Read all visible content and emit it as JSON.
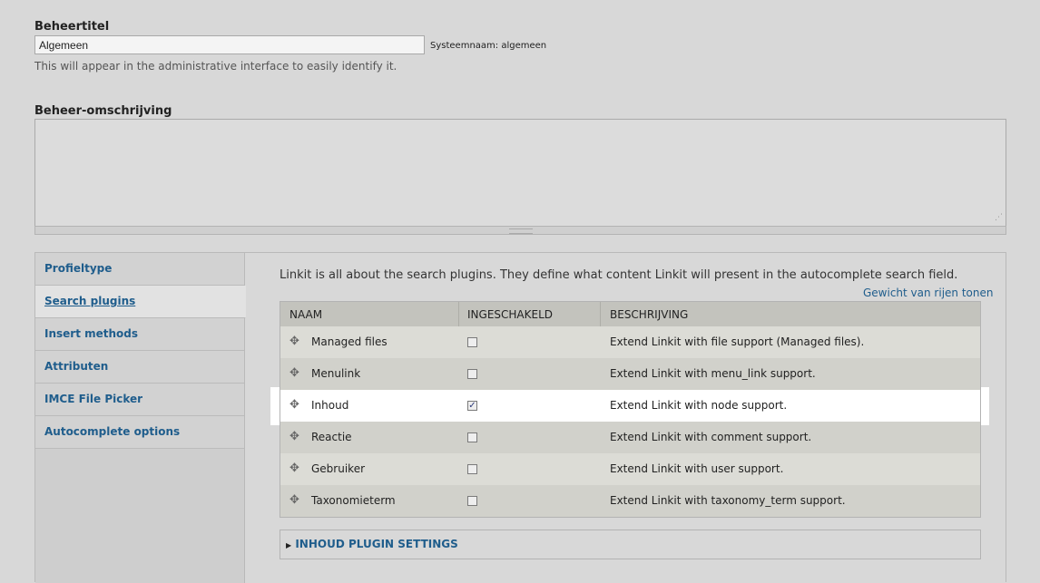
{
  "admin_title": {
    "label": "Beheertitel",
    "value": "Algemeen",
    "machine_name": "Systeemnaam: algemeen",
    "help": "This will appear in the administrative interface to easily identify it."
  },
  "admin_description": {
    "label": "Beheer-omschrijving",
    "value": ""
  },
  "vertical_tabs": [
    {
      "label": "Profieltype"
    },
    {
      "label": "Search plugins"
    },
    {
      "label": "Insert methods"
    },
    {
      "label": "Attributen"
    },
    {
      "label": "IMCE File Picker"
    },
    {
      "label": "Autocomplete options"
    }
  ],
  "search_plugins": {
    "intro": "Linkit is all about the search plugins. They define what content Linkit will present in the autocomplete search field.",
    "weights_link": "Gewicht van rijen tonen",
    "columns": [
      "NAAM",
      "INGESCHAKELD",
      "BESCHRIJVING"
    ],
    "rows": [
      {
        "name": "Managed files",
        "enabled": false,
        "description": "Extend Linkit with file support (Managed files)."
      },
      {
        "name": "Menulink",
        "enabled": false,
        "description": "Extend Linkit with menu_link support."
      },
      {
        "name": "Inhoud",
        "enabled": true,
        "description": "Extend Linkit with node support."
      },
      {
        "name": "Reactie",
        "enabled": false,
        "description": "Extend Linkit with comment support."
      },
      {
        "name": "Gebruiker",
        "enabled": false,
        "description": "Extend Linkit with user support."
      },
      {
        "name": "Taxonomieterm",
        "enabled": false,
        "description": "Extend Linkit with taxonomy_term support."
      }
    ],
    "settings_legend": "INHOUD PLUGIN SETTINGS"
  },
  "icons": {
    "drag": "drag-handle-icon",
    "collapse": "triangle-right-icon",
    "resize": "resize-grip-icon"
  },
  "colors": {
    "link": "#1f5d8c",
    "page_bg": "#d8d8d8",
    "highlight_row": "#ffffff"
  }
}
